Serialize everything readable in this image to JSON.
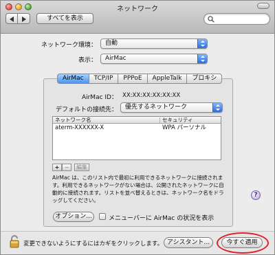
{
  "window": {
    "title": "ネットワーク"
  },
  "toolbar": {
    "show_all_label": "すべてを表示",
    "search_placeholder": ""
  },
  "network_env": {
    "label": "ネットワーク環境：",
    "value": "自動"
  },
  "display": {
    "label": "表示：",
    "value": "AirMac"
  },
  "tabs": [
    {
      "label": "AirMac",
      "active": true
    },
    {
      "label": "TCP/IP",
      "active": false
    },
    {
      "label": "PPPoE",
      "active": false
    },
    {
      "label": "AppleTalk",
      "active": false
    },
    {
      "label": "プロキシ",
      "active": false
    }
  ],
  "airmac": {
    "id_label": "AirMac ID：",
    "id_value": "XX:XX:XX:XX:XX:XX",
    "default_label": "デフォルトの接続先：",
    "default_value": "優先するネットワーク"
  },
  "network_table": {
    "columns": [
      "ネットワーク名",
      "セキュリティ"
    ],
    "rows": [
      {
        "name": "aterm-XXXXXX-X",
        "security": "WPA パーソナル"
      }
    ]
  },
  "list_buttons": {
    "add": "+",
    "remove": "−",
    "edit": "編集"
  },
  "description": "AirMac は、このリスト内で最初に利用できるネットワークに接続されます。利用できるネットワークがない場合は、公開されたネットワークに自動的に接続されます。リストを並べ替えるときは、ネットワーク名をドラッグしてください。",
  "options_button": "オプション...",
  "menubar_checkbox": {
    "label": "メニューバーに AirMac の状況を表示",
    "checked": false
  },
  "help_symbol": "?",
  "footer": {
    "lock_text": "変更できないようにするにはカギをクリックします。",
    "assistant_button": "アシスタント...",
    "apply_button": "今すぐ適用"
  },
  "colors": {
    "accent": "#4d93ea",
    "highlight_ring": "#e0202a"
  }
}
